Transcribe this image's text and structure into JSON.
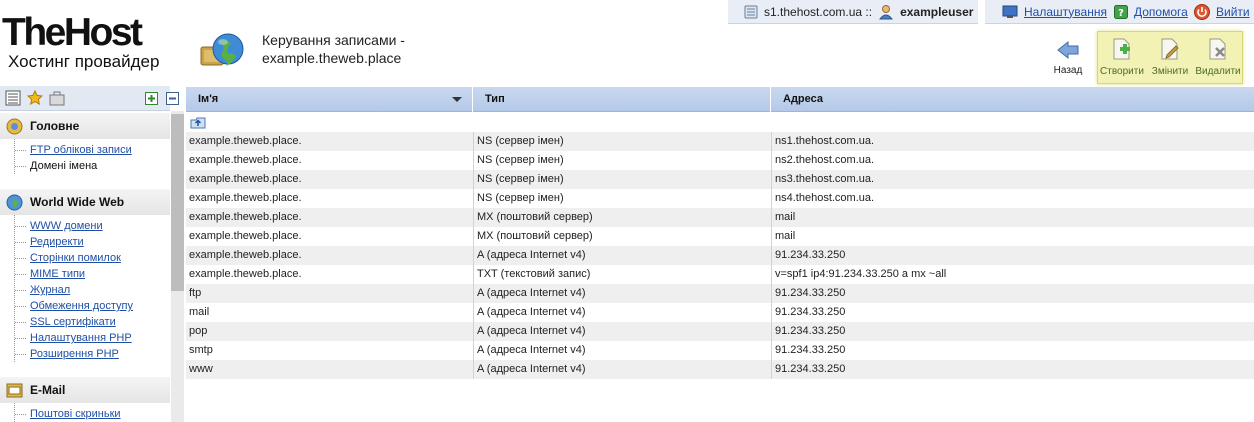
{
  "brand": {
    "name": "TheHost",
    "tagline": "Хостинг провайдер"
  },
  "page_title": {
    "line1": "Керування записами -",
    "line2": "example.theweb.place"
  },
  "topbar": {
    "server": "s1.thehost.com.ua ::",
    "user": "exampleuser",
    "settings": "Налаштування",
    "help": "Допомога",
    "logout": "Вийти"
  },
  "toolbar": {
    "back": "Назад",
    "create": "Створити",
    "edit": "Змінити",
    "delete": "Видалити"
  },
  "sidebar": {
    "sections": [
      {
        "title": "Головне",
        "items": [
          "FTP облікові записи",
          "Домені імена"
        ]
      },
      {
        "title": "World Wide Web",
        "items": [
          "WWW домени",
          "Редиректи",
          "Сторінки помилок",
          "MIME типи",
          "Журнал",
          "Обмеження доступу",
          "SSL сертифікати",
          "Налаштування PHP",
          "Розширення PHP"
        ]
      },
      {
        "title": "E-Mail",
        "items": [
          "Поштові скриньки"
        ]
      }
    ]
  },
  "table": {
    "columns": [
      "Ім'я",
      "Тип",
      "Адреса"
    ],
    "rows": [
      [
        "example.theweb.place.",
        "NS (сервер імен)",
        "ns1.thehost.com.ua."
      ],
      [
        "example.theweb.place.",
        "NS (сервер імен)",
        "ns2.thehost.com.ua."
      ],
      [
        "example.theweb.place.",
        "NS (сервер імен)",
        "ns3.thehost.com.ua."
      ],
      [
        "example.theweb.place.",
        "NS (сервер імен)",
        "ns4.thehost.com.ua."
      ],
      [
        "example.theweb.place.",
        "MX (поштовий сервер)",
        "mail"
      ],
      [
        "example.theweb.place.",
        "MX (поштовий сервер)",
        "mail"
      ],
      [
        "example.theweb.place.",
        "A (адреса Internet v4)",
        "91.234.33.250"
      ],
      [
        "example.theweb.place.",
        "TXT (текстовий запис)",
        "v=spf1 ip4:91.234.33.250 a mx ~all"
      ],
      [
        "ftp",
        "A (адреса Internet v4)",
        "91.234.33.250"
      ],
      [
        "mail",
        "A (адреса Internet v4)",
        "91.234.33.250"
      ],
      [
        "pop",
        "A (адреса Internet v4)",
        "91.234.33.250"
      ],
      [
        "smtp",
        "A (адреса Internet v4)",
        "91.234.33.250"
      ],
      [
        "www",
        "A (адреса Internet v4)",
        "91.234.33.250"
      ]
    ]
  },
  "icons": {
    "globe": "globe-package-icon",
    "server": "server-icon",
    "user": "user-icon",
    "settings": "monitor-settings-icon",
    "help": "help-icon",
    "logout": "power-icon",
    "back": "back-arrow-icon",
    "create": "create-doc-icon",
    "edit": "edit-doc-icon",
    "delete": "delete-doc-icon",
    "expand": "plus-icon",
    "collapse": "minus-icon",
    "up": "up-folder-icon"
  },
  "colors": {
    "accent": "#b4c9e8",
    "link": "#1f4fa6",
    "action_panel": "#f2f2b5"
  }
}
